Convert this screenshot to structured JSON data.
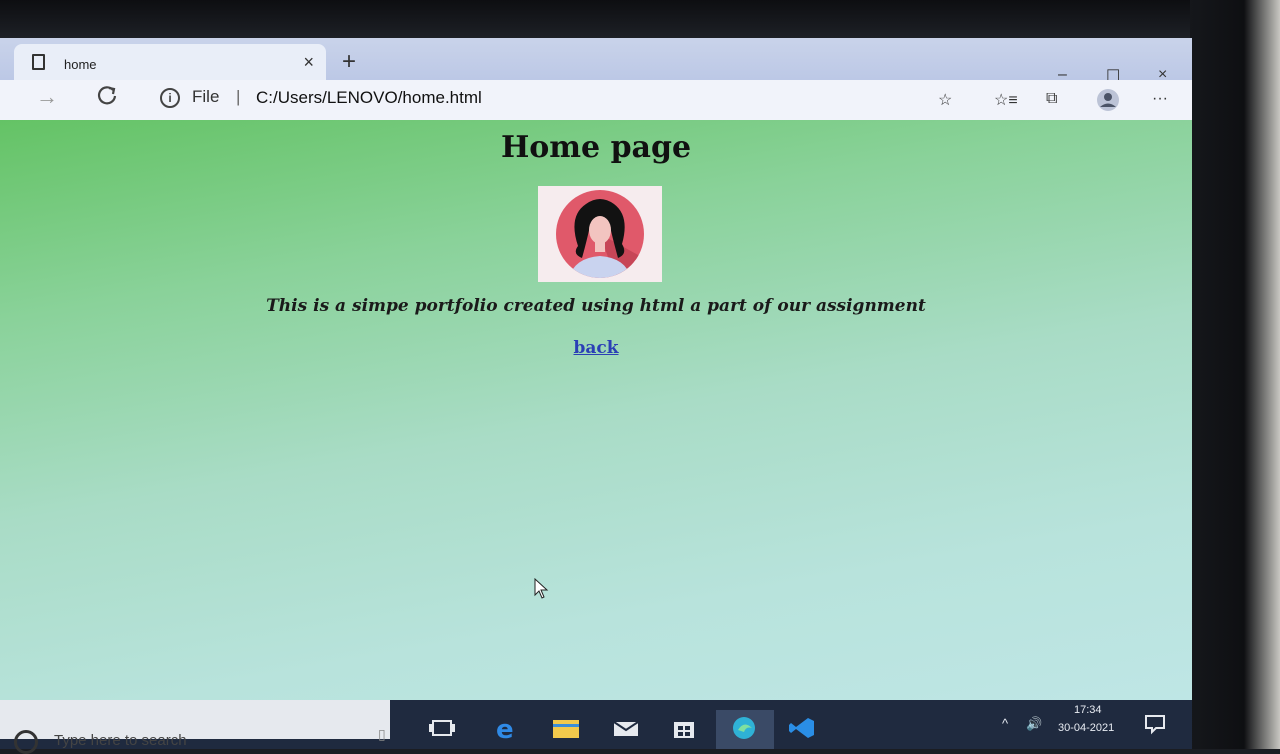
{
  "browser": {
    "tab_title": "home",
    "address_scheme": "File",
    "address_separator": "|",
    "address_url": "C:/Users/LENOVO/home.html",
    "new_tab_symbol": "+",
    "tab_close_symbol": "×",
    "window_controls": [
      "–",
      "☐",
      "×"
    ],
    "nav": {
      "forward": "→",
      "reload": "C"
    },
    "toolbar_icons": [
      "add-favorite-icon",
      "favorites-icon",
      "collections-icon",
      "profile-icon",
      "more-icon"
    ],
    "more_label": "···"
  },
  "page": {
    "heading": "Home page",
    "description": "This is a simpe portfolio created using html a part of our assignment",
    "back_link": "back"
  },
  "taskbar": {
    "search_placeholder": "Type here to search",
    "time": "17:34",
    "date": "30-04-2021",
    "apps": [
      "task-view-icon",
      "edge-legacy-icon",
      "file-explorer-icon",
      "mail-icon",
      "store-icon",
      "edge-icon",
      "vscode-icon"
    ]
  },
  "colors": {
    "page_bg_top": "#64c365",
    "page_bg_bottom": "#bfe6e6",
    "link": "#2b3fb6",
    "taskbar": "#1f2a3f"
  }
}
